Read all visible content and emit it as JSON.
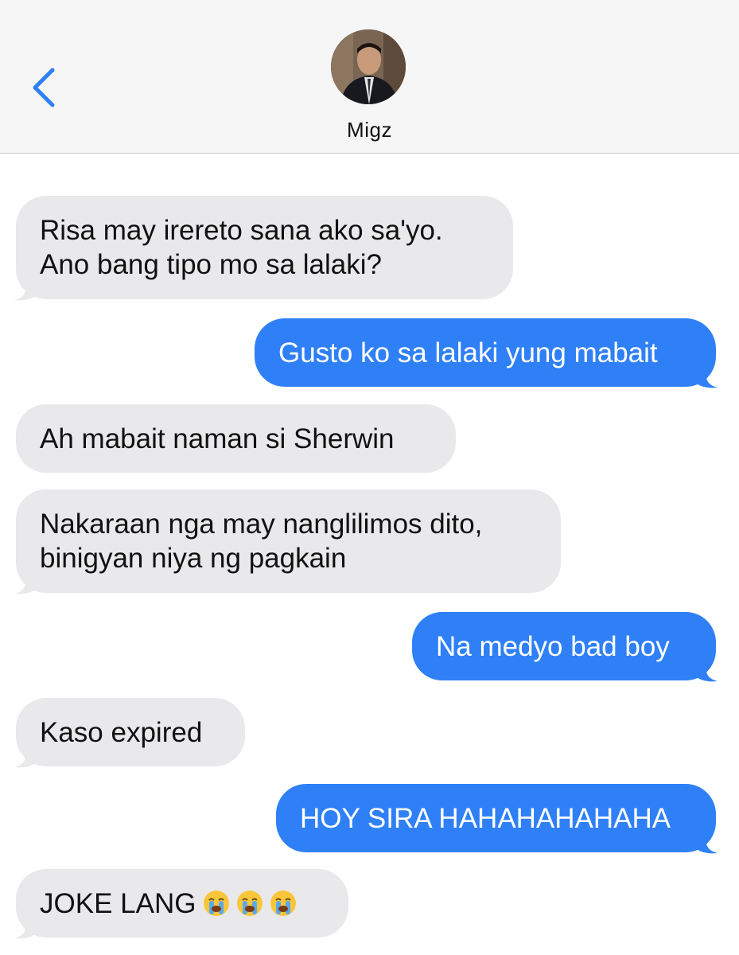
{
  "header": {
    "contact_name": "Migz"
  },
  "colors": {
    "incoming_bubble": "#e9e9eb",
    "outgoing_bubble": "#2f80f6",
    "back_chevron": "#2f80f6"
  },
  "messages": [
    {
      "from": "them",
      "lines": [
        "Risa may irereto sana ako sa'yo.",
        "Ano bang tipo mo sa lalaki?"
      ]
    },
    {
      "from": "me",
      "lines": [
        "Gusto ko sa lalaki yung mabait"
      ]
    },
    {
      "from": "them",
      "lines": [
        "Ah mabait naman si Sherwin"
      ]
    },
    {
      "from": "them",
      "lines": [
        "Nakaraan nga may nanglilimos dito,",
        "binigyan niya ng pagkain"
      ]
    },
    {
      "from": "me",
      "lines": [
        "Na medyo bad boy"
      ]
    },
    {
      "from": "them",
      "lines": [
        "Kaso expired"
      ]
    },
    {
      "from": "me",
      "lines": [
        "HOY SIRA HAHAHAHAHAHA"
      ]
    },
    {
      "from": "them",
      "lines": [
        "JOKE LANG"
      ],
      "emoji": [
        "crying-face-emoji",
        "crying-face-emoji",
        "crying-face-emoji"
      ]
    }
  ]
}
